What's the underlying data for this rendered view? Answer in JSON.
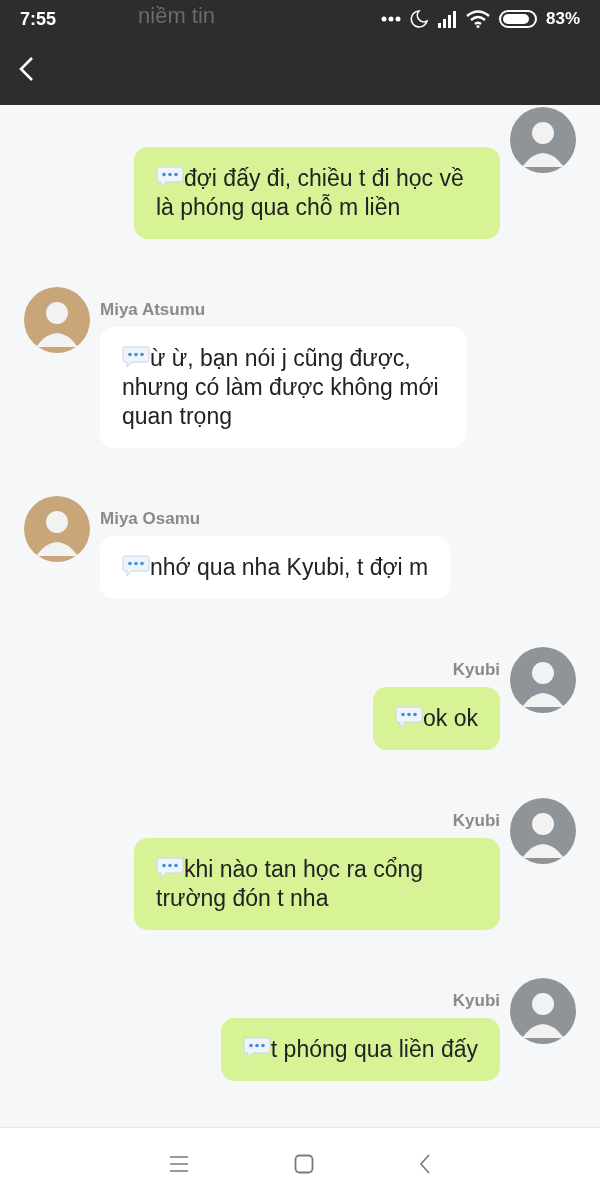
{
  "status_bar": {
    "time": "7:55",
    "battery": "83%"
  },
  "header": {
    "title": "niềm tin"
  },
  "messages": [
    {
      "kind": "sent",
      "text": "đợi đấy đi, chiều t đi học về là phóng qua chỗ m liền"
    },
    {
      "kind": "received",
      "name": "Miya Atsumu",
      "text": "ừ ừ, bạn nói j cũng được, nhưng có làm được không mới quan trọng"
    },
    {
      "kind": "received",
      "name": "Miya Osamu",
      "text": "nhớ qua nha Kyubi, t đợi m"
    },
    {
      "kind": "sent",
      "name": "Kyubi",
      "text": "ok ok"
    },
    {
      "kind": "sent",
      "name": "Kyubi",
      "text": "khi nào tan học ra cổng trường đón t nha"
    },
    {
      "kind": "sent",
      "name": "Kyubi",
      "text": "t phóng qua liền đấy"
    }
  ]
}
